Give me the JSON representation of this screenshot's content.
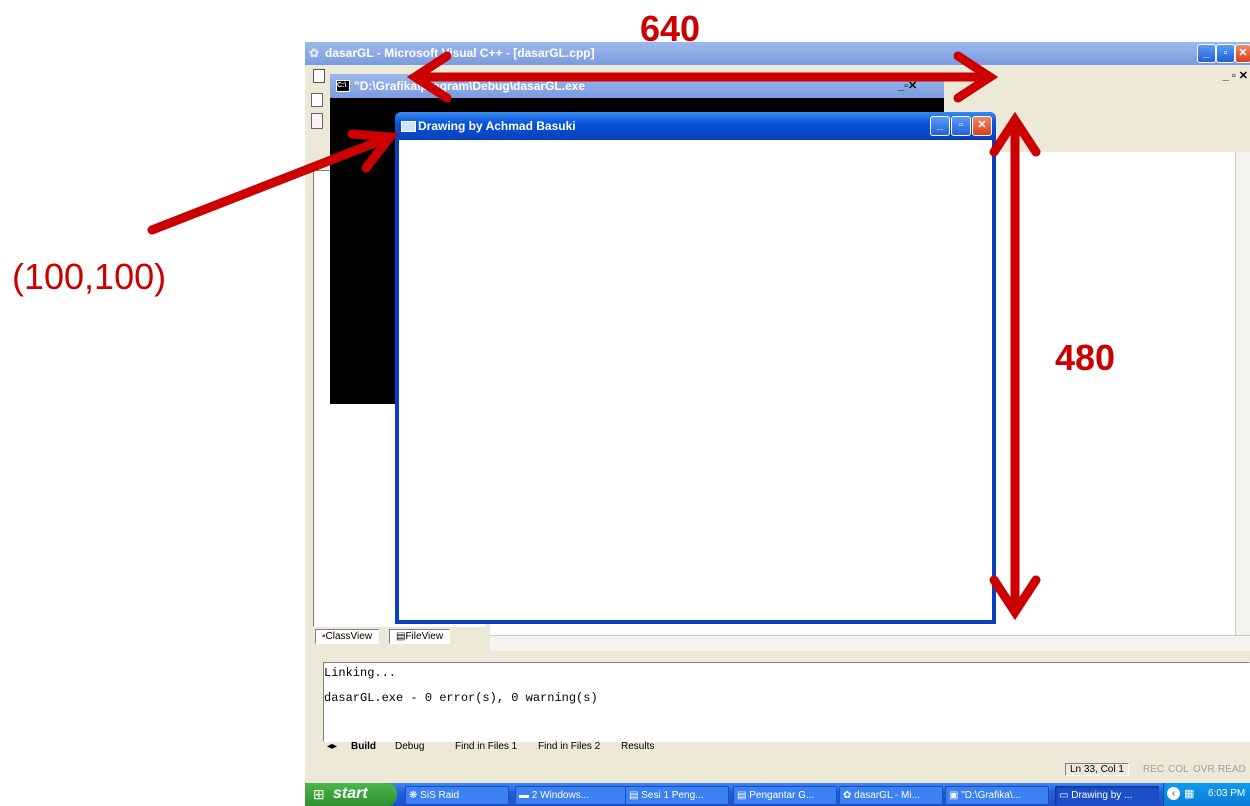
{
  "ide": {
    "title": "dasarGL - Microsoft Visual C++ - [dasarGL.cpp]",
    "sidebar_tabs": [
      "ClassView",
      "FileView"
    ]
  },
  "console": {
    "title": "\"D:\\Grafika\\program\\Debug\\dasarGL.exe"
  },
  "drawing": {
    "title": "Drawing by Achmad Basuki"
  },
  "output": {
    "lines": [
      "Linking...",
      "dasarGL.exe - 0 error(s), 0 warning(s)"
    ],
    "tabs": [
      "Build",
      "Debug",
      "Find in Files 1",
      "Find in Files 2",
      "Results"
    ]
  },
  "status": {
    "position": "Ln 33, Col 1",
    "indicators": [
      "REC",
      "COL",
      "OVR",
      "READ"
    ]
  },
  "taskbar": {
    "start": "start",
    "items": [
      "SiS Raid",
      "2 Windows...",
      "Sesi 1 Peng...",
      "Pengantar G...",
      "dasarGL - Mi...",
      "\"D:\\Grafika\\...",
      "Drawing by ..."
    ],
    "clock": "6:03 PM"
  },
  "annotations": {
    "width": "640",
    "height": "480",
    "origin": "(100,100)",
    "arrow_color": "#cc0000"
  }
}
